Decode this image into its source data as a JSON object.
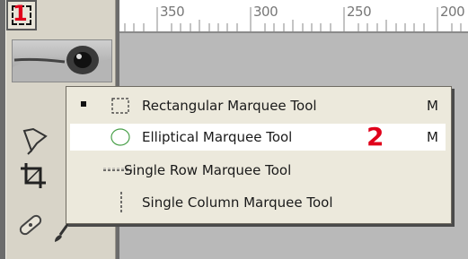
{
  "ruler": {
    "labels": [
      "350",
      "300",
      "250",
      "200"
    ]
  },
  "toolbox": {
    "marquee_annotation": "1",
    "icons": [
      "eye-logo",
      "marquee-icon",
      "lasso-icon",
      "crop-icon",
      "healing-brush-icon",
      "brush-icon"
    ]
  },
  "menu": {
    "items": [
      {
        "label": "Rectangular Marquee Tool",
        "key": "M",
        "icon": "rect-marquee-icon",
        "active": true
      },
      {
        "label": "Elliptical Marquee Tool",
        "key": "M",
        "icon": "ellipse-marquee-icon",
        "annotation": "2"
      },
      {
        "label": "Single Row Marquee Tool",
        "key": "",
        "icon": "single-row-icon"
      },
      {
        "label": "Single Column Marquee Tool",
        "key": "",
        "icon": "single-column-icon"
      }
    ]
  },
  "colors": {
    "annotation": "#e0001a",
    "menu_bg": "#ece9dc",
    "toolbox_bg": "#d8d4c8"
  }
}
